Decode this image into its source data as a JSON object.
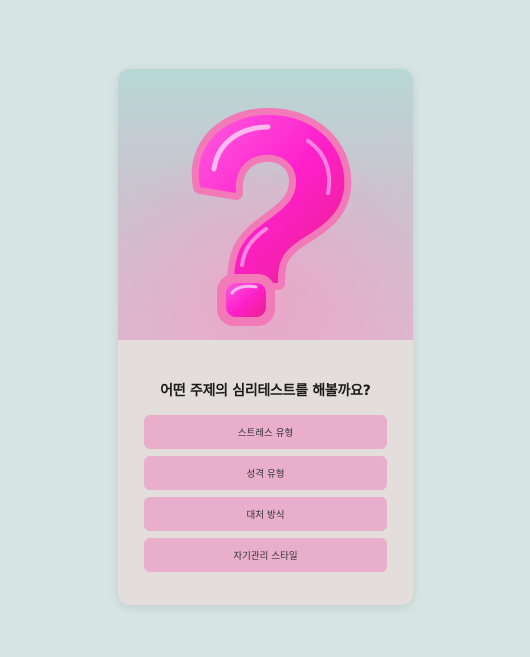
{
  "quiz": {
    "question": "어떤 주제의 심리테스트를 해볼까요?",
    "options": [
      {
        "label": "스트레스 유형"
      },
      {
        "label": "성격 유형"
      },
      {
        "label": "대처 방식"
      },
      {
        "label": "자기관리 스타일"
      }
    ]
  },
  "hero": {
    "icon": "question-mark-icon",
    "colors": {
      "gradient_top": "#b8d8d6",
      "gradient_bottom": "#dcb8ce",
      "icon_main": "#ff2fd0",
      "icon_edge": "#f05aa8"
    }
  },
  "theme": {
    "page_background": "#d6e4e3",
    "card_background": "#e3dedb",
    "button_color": "#e9aecb",
    "text_color": "#1a1a1a"
  }
}
